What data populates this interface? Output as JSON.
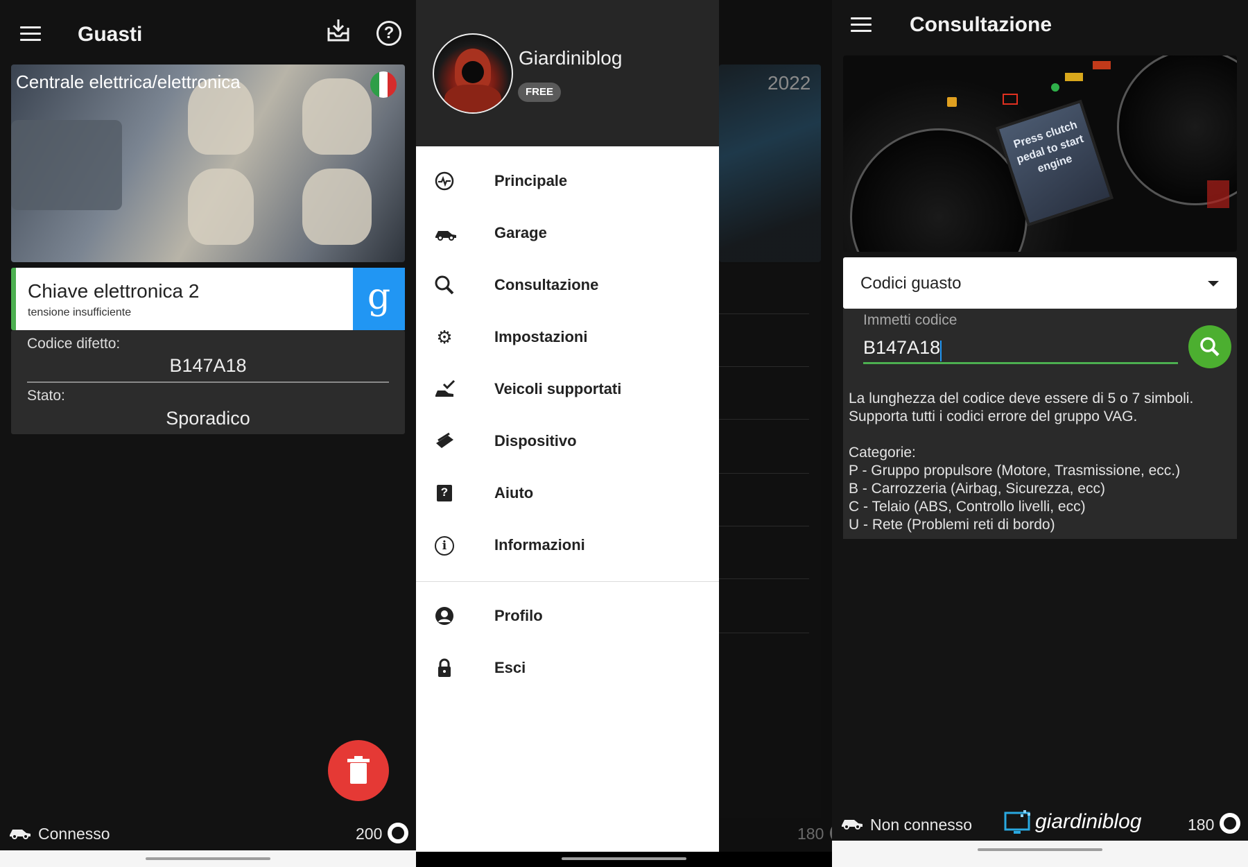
{
  "panel1": {
    "title": "Guasti",
    "banner_text": "Centrale elettrica/elettronica",
    "card": {
      "title": "Chiave elettronica 2",
      "subtitle": "tensione insufficiente",
      "google_letter": "g"
    },
    "info": {
      "code_label": "Codice difetto:",
      "code_value": "B147A18",
      "state_label": "Stato:",
      "state_value": "Sporadico"
    },
    "status": {
      "connection": "Connesso",
      "count": "200"
    }
  },
  "panel2": {
    "user": {
      "name": "Giardiniblog",
      "badge": "FREE"
    },
    "background_year": "2022",
    "menu": [
      {
        "label": "Principale",
        "icon": "activity-icon"
      },
      {
        "label": "Garage",
        "icon": "car-icon"
      },
      {
        "label": "Consultazione",
        "icon": "search-icon"
      },
      {
        "label": "Impostazioni",
        "icon": "gear-icon"
      },
      {
        "label": "Veicoli supportati",
        "icon": "car-check-icon"
      },
      {
        "label": "Dispositivo",
        "icon": "device-icon"
      },
      {
        "label": "Aiuto",
        "icon": "help-icon"
      },
      {
        "label": "Informazioni",
        "icon": "info-icon"
      }
    ],
    "menu2": [
      {
        "label": "Profilo",
        "icon": "profile-icon"
      },
      {
        "label": "Esci",
        "icon": "lock-icon"
      }
    ],
    "status": {
      "count": "180"
    }
  },
  "panel3": {
    "title": "Consultazione",
    "dashboard_lcd": "Press clutch pedal to start engine",
    "dropdown": "Codici guasto",
    "input_label": "Immetti codice",
    "input_value": "B147A18",
    "description": [
      "La lunghezza del codice deve essere di 5 o 7 simboli.",
      "Supporta tutti i codici errore del gruppo VAG."
    ],
    "categories_title": "Categorie:",
    "categories": [
      "P - Gruppo propulsore (Motore, Trasmissione, ecc.)",
      "B - Carrozzeria (Airbag, Sicurezza, ecc)",
      "C - Telaio (ABS, Controllo livelli, ecc)",
      "U - Rete (Problemi reti di bordo)"
    ],
    "status": {
      "connection": "Non connesso",
      "logo": "giardiniblog",
      "count": "180"
    }
  },
  "colors": {
    "green": "#4caf50",
    "blue": "#2196f3",
    "red": "#e53935",
    "dark": "#121212"
  }
}
